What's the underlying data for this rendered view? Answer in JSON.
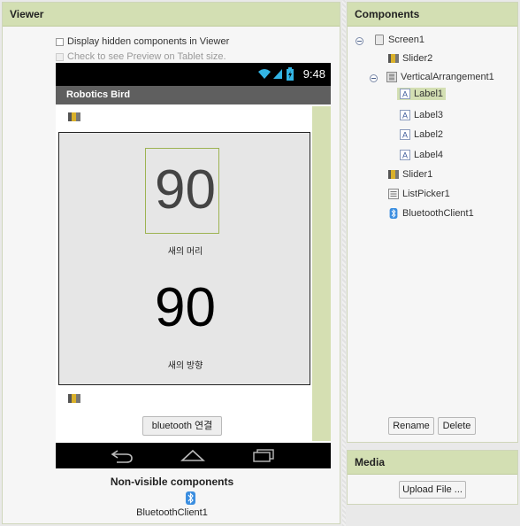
{
  "viewer": {
    "title": "Viewer",
    "show_hidden_label": "Display hidden components in Viewer",
    "tablet_preview_label": "Check to see Preview on Tablet size.",
    "phone": {
      "clock": "9:48",
      "app_title": "Robotics Bird",
      "label1_value": "90",
      "label3_text": "새의 머리",
      "label2_value": "90",
      "label4_text": "새의 방향",
      "bluetooth_button": "bluetooth 연결"
    },
    "nonvisible_title": "Non-visible components",
    "nonvisible_items": [
      "BluetoothClient1"
    ]
  },
  "components": {
    "title": "Components",
    "tree": {
      "screen": "Screen1",
      "slider2": "Slider2",
      "varr": "VerticalArrangement1",
      "label1": "Label1",
      "label3": "Label3",
      "label2": "Label2",
      "label4": "Label4",
      "slider1": "Slider1",
      "listpicker": "ListPicker1",
      "bluetooth": "BluetoothClient1"
    },
    "rename_label": "Rename",
    "delete_label": "Delete"
  },
  "media": {
    "title": "Media",
    "upload_label": "Upload File ..."
  },
  "colors": {
    "panel_header": "#d3dfb3",
    "selection": "#d3dfb3",
    "accent_green": "#9db352"
  }
}
